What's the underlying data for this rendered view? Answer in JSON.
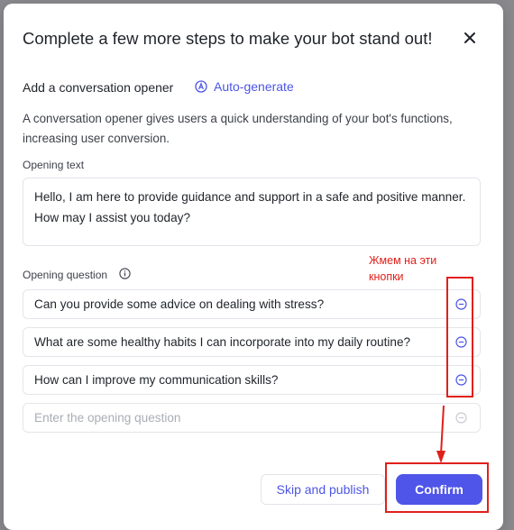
{
  "dialog": {
    "title": "Complete a few more steps to make your bot stand out!",
    "close_icon": "close-icon"
  },
  "opener": {
    "section_label": "Add a conversation opener",
    "autogen_label": "Auto-generate",
    "description": "A conversation opener gives users a quick understanding of your bot's functions, increasing user conversion."
  },
  "opening_text": {
    "label": "Opening text",
    "value": "Hello, I am here to provide guidance and support in a safe and positive manner. How may I assist you today?"
  },
  "opening_question": {
    "label": "Opening question",
    "questions": [
      "Can you provide some advice on dealing with stress?",
      "What are some healthy habits I can incorporate into my daily routine?",
      "How can I improve my communication skills?"
    ],
    "placeholder": "Enter the opening question"
  },
  "annotation": {
    "text": "Жмем на эти кнопки"
  },
  "footer": {
    "skip_label": "Skip and publish",
    "confirm_label": "Confirm"
  },
  "colors": {
    "accent": "#4c55e6",
    "annotation": "#e0201a"
  }
}
